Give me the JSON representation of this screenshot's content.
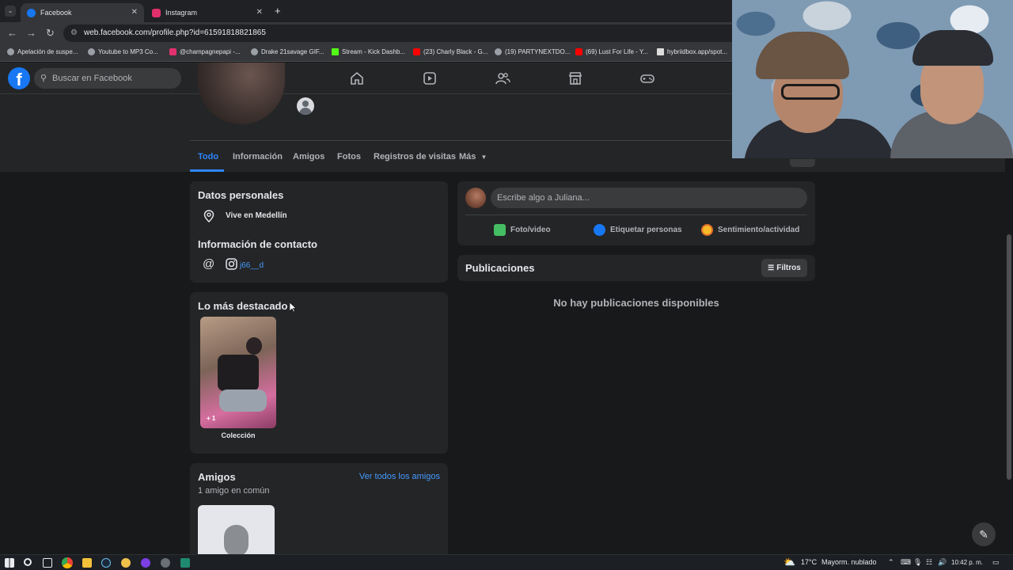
{
  "browser": {
    "tabs": [
      {
        "label": "Facebook",
        "icon": "facebook-icon",
        "color": "#1877f2"
      },
      {
        "label": "Instagram",
        "icon": "instagram-icon",
        "color": "#e1306c"
      }
    ],
    "new_tab_symbol": "+",
    "url": "web.facebook.com/profile.php?id=61591818821865",
    "bookmarks": [
      {
        "label": "Apelación de suspe...",
        "icon": "globe-icon",
        "color": "#9aa0a6"
      },
      {
        "label": "Youtube to MP3 Co...",
        "icon": "globe-icon",
        "color": "#9aa0a6"
      },
      {
        "label": "@champagnepapi -...",
        "icon": "instagram-icon",
        "color": "#e1306c"
      },
      {
        "label": "Drake 21savage GIF...",
        "icon": "globe-icon",
        "color": "#9aa0a6"
      },
      {
        "label": "Stream - Kick Dashb...",
        "icon": "kick-icon",
        "color": "#53fc18"
      },
      {
        "label": "(23) Charly Black - G...",
        "icon": "youtube-icon",
        "color": "#ff0000"
      },
      {
        "label": "(19) PARTYNEXTDO...",
        "icon": "globe-icon",
        "color": "#9aa0a6"
      },
      {
        "label": "(69) Lust For Life - Y...",
        "icon": "youtube-icon",
        "color": "#ff0000"
      },
      {
        "label": "hybriidbox.app/spot...",
        "icon": "hb-icon",
        "color": "#dddddd"
      }
    ]
  },
  "facebook": {
    "search_placeholder": "Buscar en Facebook",
    "brand_color": "#1877f2",
    "profile_tabs": [
      "Todo",
      "Información",
      "Amigos",
      "Fotos",
      "Registros de visitas",
      "Más"
    ],
    "active_tab": "Todo",
    "personal": {
      "title": "Datos personales",
      "lives": "Vive en Medellín",
      "contact_title": "Información de contacto",
      "instagram_handle": "j66__d"
    },
    "highlights": {
      "title": "Lo más destacado",
      "collection_label": "Colección",
      "collection_badge": "+ 1"
    },
    "friends": {
      "title": "Amigos",
      "see_all": "Ver todos los amigos",
      "mutual": "1 amigo en común"
    },
    "composer": {
      "placeholder": "Escribe algo a Juliana...",
      "actions": [
        "Foto/video",
        "Etiquetar personas",
        "Sentimiento/actividad"
      ]
    },
    "posts": {
      "title": "Publicaciones",
      "filters_label": "Filtros",
      "empty_message": "No hay publicaciones disponibles"
    }
  },
  "taskbar": {
    "temperature": "17°C",
    "weather": "Mayorm. nublado",
    "time": "10:42 p. m."
  }
}
